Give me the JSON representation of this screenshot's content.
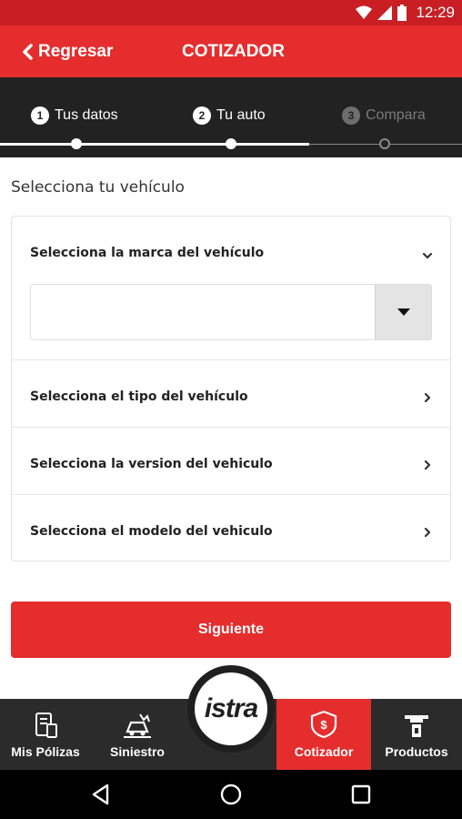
{
  "status_bar": {
    "time": "12:29"
  },
  "header": {
    "back_label": "Regresar",
    "title": "COTIZADOR"
  },
  "stepper": {
    "steps": [
      {
        "number": "1",
        "label": "Tus datos"
      },
      {
        "number": "2",
        "label": "Tu auto"
      },
      {
        "number": "3",
        "label": "Compara"
      }
    ]
  },
  "main": {
    "subtitle": "Selecciona tu vehículo",
    "sections": [
      {
        "label": "Selecciona la marca del vehículo"
      },
      {
        "label": "Selecciona el tipo del vehículo"
      },
      {
        "label": "Selecciona la version del vehiculo"
      },
      {
        "label": "Selecciona el modelo del vehiculo"
      }
    ],
    "brand_select_value": "",
    "next_button": "Siguiente"
  },
  "bottom_nav": {
    "logo": "istra",
    "items": [
      {
        "label": "Mis Pólizas",
        "icon": "document-phone-icon"
      },
      {
        "label": "Siniestro",
        "icon": "car-crash-icon"
      },
      {
        "label": "Cotizador",
        "icon": "shield-money-icon"
      },
      {
        "label": "Productos",
        "icon": "tools-icon"
      }
    ]
  },
  "colors": {
    "accent": "#e52d2d",
    "dark": "#222222"
  }
}
